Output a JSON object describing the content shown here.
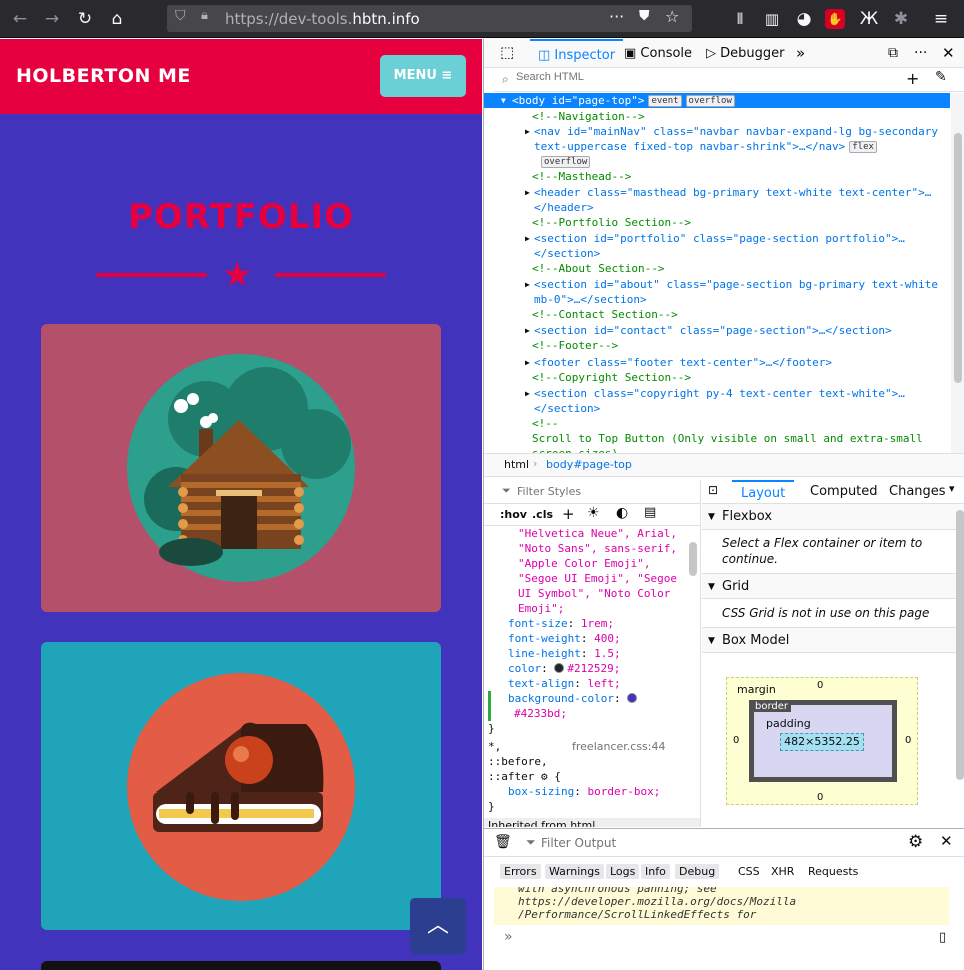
{
  "browser": {
    "url_prefix": "https://dev-tools.",
    "url_host": "hbtn.info"
  },
  "page": {
    "brand": "HOLBERTON ME",
    "menu_label": "MENU ≡",
    "section_title": "PORTFOLIO",
    "colors": {
      "nav": "#e6003f",
      "body": "#4233bd",
      "card1": "#b4506a",
      "card2": "#1fa4b9"
    }
  },
  "devtools": {
    "tabs": {
      "inspector": "Inspector",
      "console": "Console",
      "debugger": "Debugger"
    },
    "search_placeholder": "Search HTML",
    "html_lines": [
      {
        "t": "<body id=\"page-top\">",
        "b": [
          "event",
          "overflow"
        ]
      },
      {
        "t": "<!--Navigation-->"
      },
      {
        "t": "<nav id=\"mainNav\" class=\"navbar navbar-expand-lg bg-secondary"
      },
      {
        "t": "text-uppercase fixed-top navbar-shrink\">…</nav>",
        "b": [
          "flex"
        ]
      },
      {
        "t": "",
        "b": [
          "overflow"
        ]
      },
      {
        "t": "<!--Masthead-->"
      },
      {
        "t": "<header class=\"masthead bg-primary text-white text-center\">…"
      },
      {
        "t": "</header>"
      },
      {
        "t": "<!--Portfolio Section-->"
      },
      {
        "t": "<section id=\"portfolio\" class=\"page-section portfolio\">…"
      },
      {
        "t": "</section>"
      },
      {
        "t": "<!--About Section-->"
      },
      {
        "t": "<section id=\"about\" class=\"page-section bg-primary text-white"
      },
      {
        "t": "mb-0\">…</section>"
      },
      {
        "t": "<!--Contact Section-->"
      },
      {
        "t": "<section id=\"contact\" class=\"page-section\">…</section>"
      },
      {
        "t": "<!--Footer-->"
      },
      {
        "t": "<footer class=\"footer text-center\">…</footer>"
      },
      {
        "t": "<!--Copyright Section-->"
      },
      {
        "t": "<section class=\"copyright py-4 text-center text-white\">…"
      },
      {
        "t": "</section>"
      },
      {
        "t": "<!--"
      },
      {
        "t": "Scroll to Top Button (Only visible on small and extra-small"
      },
      {
        "t": "screen sizes)"
      }
    ],
    "breadcrumb": [
      "html",
      "body#page-top"
    ],
    "rules_filter": "Filter Styles",
    "rules_tools": [
      ":hov",
      ".cls"
    ],
    "rules_lines": [
      {
        "i": 2,
        "v": "\"Helvetica Neue\", Arial,"
      },
      {
        "i": 2,
        "v": "\"Noto Sans\", sans-serif,"
      },
      {
        "i": 2,
        "v": "\"Apple Color Emoji\","
      },
      {
        "i": 2,
        "v": "\"Segoe UI Emoji\", \"Segoe"
      },
      {
        "i": 2,
        "v": "UI Symbol\", \"Noto Color"
      },
      {
        "i": 2,
        "v": "Emoji\";"
      },
      {
        "p": "font-size",
        "v": "1rem;"
      },
      {
        "p": "font-weight",
        "v": "400;"
      },
      {
        "p": "line-height",
        "v": "1.5;"
      },
      {
        "p": "color",
        "v": "#212529;",
        "sw": "#212529"
      },
      {
        "p": "text-align",
        "v": "left;"
      },
      {
        "p": "background-color",
        "v": "",
        "sw": "#4233bd"
      },
      {
        "i": 2,
        "v": "#4233bd;"
      },
      {
        "i": 0,
        "v": "}"
      },
      {
        "i": 0,
        "v": "*,",
        "src": "freelancer.css:44"
      },
      {
        "i": 0,
        "v": "::before,"
      },
      {
        "i": 0,
        "v": "::after ⚙ {"
      },
      {
        "p": "box-sizing",
        "v": "border-box;"
      },
      {
        "i": 0,
        "v": "}"
      },
      {
        "i": 0,
        "v": "Inherited from html"
      }
    ],
    "layout_tabs": [
      "Layout",
      "Computed",
      "Changes"
    ],
    "flexbox": {
      "title": "Flexbox",
      "msg": "Select a Flex container or item to continue."
    },
    "grid": {
      "title": "Grid",
      "msg": "CSS Grid is not in use on this page"
    },
    "boxmodel": {
      "title": "Box Model",
      "margin": "margin",
      "border": "border",
      "padding": "padding",
      "size": "482×5352.25",
      "zero": "0"
    },
    "console": {
      "filter": "Filter Output",
      "filters": [
        "Errors",
        "Warnings",
        "Logs",
        "Info",
        "Debug"
      ],
      "extra": [
        "CSS",
        "XHR",
        "Requests"
      ],
      "lines": [
        "with asynchronous panning; see",
        "https://developer.mozilla.org/docs/Mozilla",
        "/Performance/ScrollLinkedEffects for"
      ],
      "prompt": "»"
    }
  }
}
